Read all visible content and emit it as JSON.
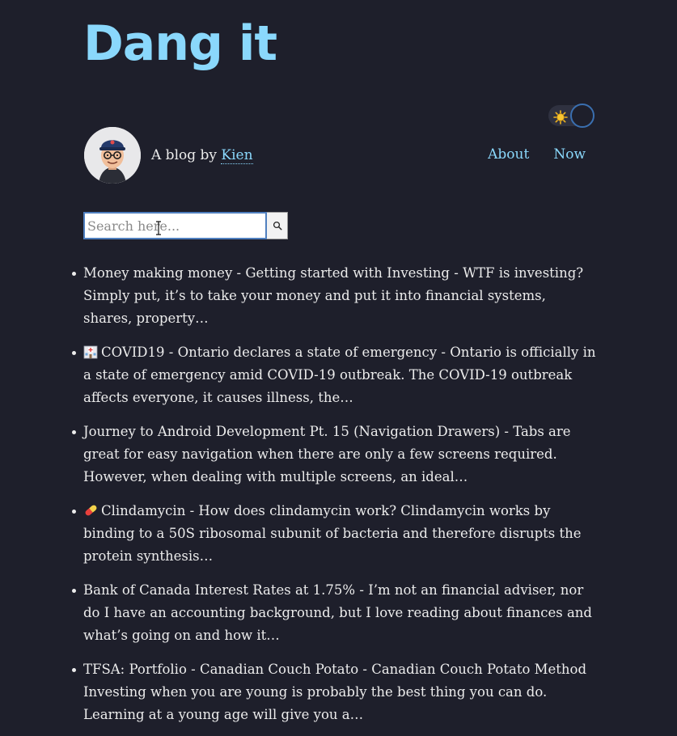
{
  "site": {
    "title": "Dang it"
  },
  "author": {
    "byline_prefix": "A blog by",
    "name": "Kien"
  },
  "nav": {
    "about": "About",
    "now": "Now"
  },
  "theme_toggle": {
    "icon": "sun-icon",
    "state": "dark"
  },
  "search": {
    "placeholder": "Search here...",
    "button_icon": "search-icon"
  },
  "posts": [
    {
      "emoji": "",
      "title": "Money making money - Getting started with Investing",
      "excerpt": "WTF is investing? Simply put, it’s to take your money and put it into financial systems, shares, property…"
    },
    {
      "emoji": "hospital-icon",
      "title": "COVID19 - Ontario declares a state of emergency",
      "excerpt": "Ontario is officially in a state of emergency amid COVID-19 outbreak. The COVID-19 outbreak affects everyone, it causes illness, the…"
    },
    {
      "emoji": "",
      "title": "Journey to Android Development Pt. 15 (Navigation Drawers)",
      "excerpt": "Tabs are great for easy navigation when there are only a few screens required. However, when dealing with multiple screens, an ideal…"
    },
    {
      "emoji": "pill-icon",
      "title": "Clindamycin",
      "excerpt": "How does clindamycin work? Clindamycin works by binding to a 50S ribosomal subunit of bacteria and therefore disrupts the protein synthesis…"
    },
    {
      "emoji": "",
      "title": "Bank of Canada Interest Rates at 1.75%",
      "excerpt": "I’m not an financial adviser, nor do I have an accounting background, but I love reading about finances and what’s going on and how it…"
    },
    {
      "emoji": "",
      "title": "TFSA: Portfolio - Canadian Couch Potato",
      "excerpt": "Canadian Couch Potato Method Investing when you are young is probably the best thing you can do. Learning at a young age will give you a…"
    }
  ],
  "colors": {
    "background": "#1e1f2b",
    "accent": "#8ad8fc",
    "text": "#ececec"
  }
}
